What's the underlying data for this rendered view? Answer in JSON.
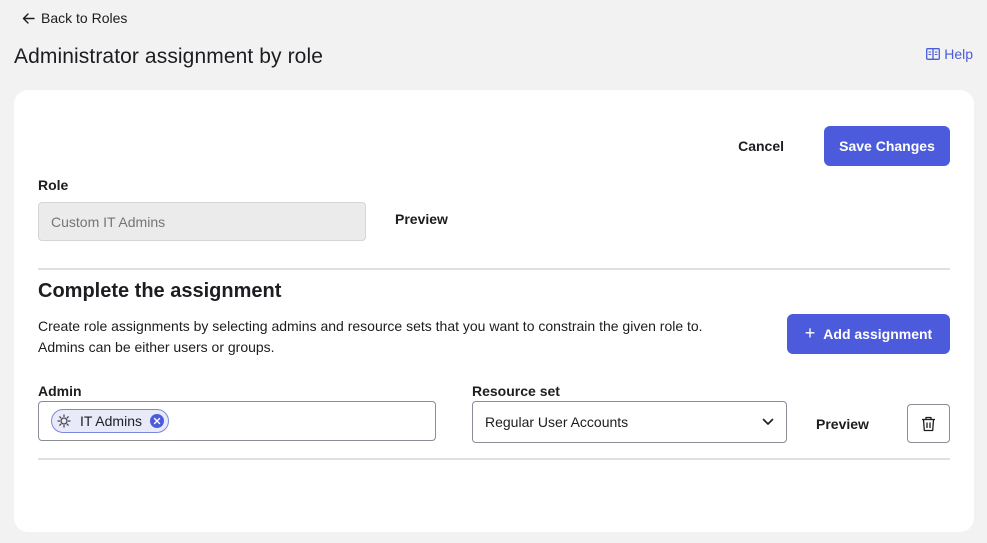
{
  "nav": {
    "back_label": "Back to Roles",
    "back_icon": "arrow-left-icon"
  },
  "header": {
    "title": "Administrator assignment by role",
    "help_label": "Help",
    "help_icon": "book-icon"
  },
  "actions": {
    "cancel_label": "Cancel",
    "save_label": "Save Changes"
  },
  "role": {
    "label": "Role",
    "value": "",
    "placeholder": "Custom IT Admins",
    "preview_label": "Preview"
  },
  "assignment": {
    "title": "Complete the assignment",
    "description_line1": "Create role assignments by selecting admins and resource sets that you want to constrain the given role to.",
    "description_line2": "Admins can be either users or groups.",
    "add_button_label": "Add assignment",
    "add_icon": "plus-icon"
  },
  "row": {
    "admin_label": "Admin",
    "admin_chips": [
      {
        "label": "IT Admins",
        "icon": "group-icon"
      }
    ],
    "resource_label": "Resource set",
    "resource_value": "Regular User Accounts",
    "preview_label": "Preview",
    "delete_icon": "trash-icon"
  },
  "colors": {
    "primary": "#4b5bdb",
    "background": "#f2f2f2",
    "card": "#ffffff",
    "chip_bg": "#e8eafa"
  }
}
